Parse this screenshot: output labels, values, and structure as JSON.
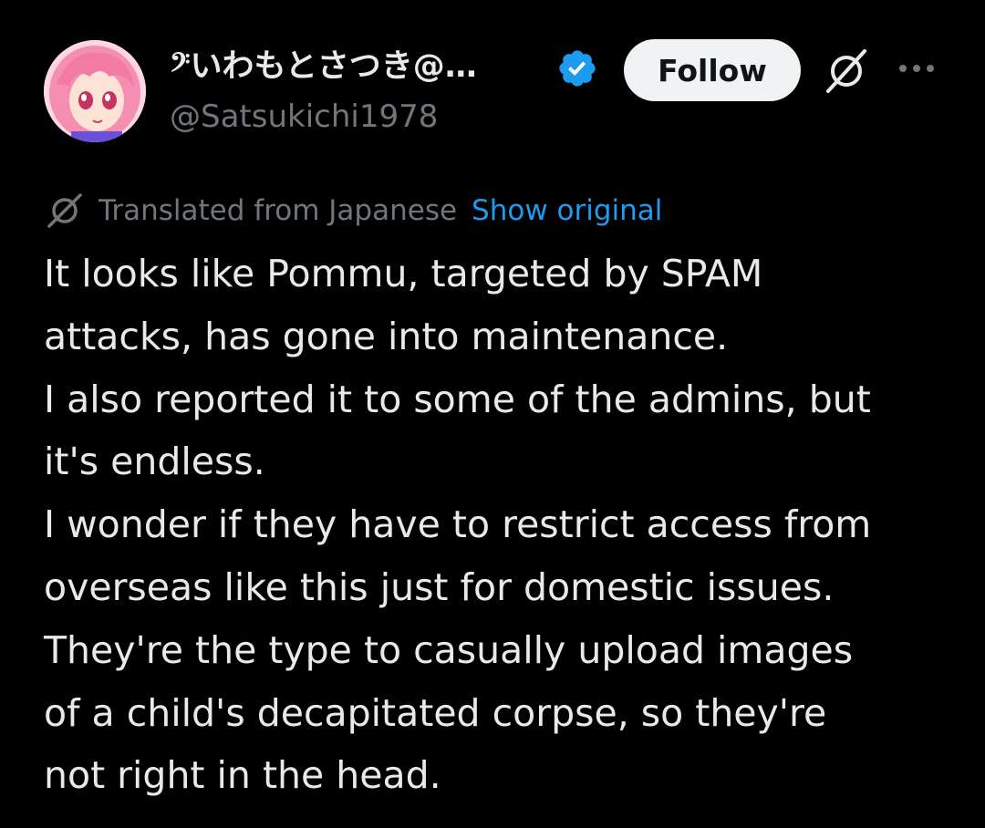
{
  "user": {
    "display_name": "𝄢いわもとさつき@…",
    "handle": "@Satsukichi1978",
    "verified_icon": "verified-badge-icon",
    "verified_color": "#1d9bf0"
  },
  "actions": {
    "follow_label": "Follow",
    "grok_icon": "grok-icon",
    "more_icon": "more-options-icon"
  },
  "translation": {
    "icon": "translate-icon",
    "label": "Translated from Japanese",
    "show_original_label": "Show original"
  },
  "tweet": {
    "lines": [
      "It looks like Pommu, targeted by SPAM",
      "attacks, has gone into maintenance.",
      "I also reported it to some of the admins, but",
      "it's endless.",
      "I wonder if they have to restrict access from",
      "overseas like this just for domestic issues.",
      "They're the type to casually upload images",
      "of a child's decapitated corpse, so they're",
      "not right in the head."
    ]
  },
  "colors": {
    "background": "#000000",
    "text_primary": "#e7e9ea",
    "text_secondary": "#71767b",
    "link": "#1d9bf0",
    "follow_button_bg": "#eff3f4"
  }
}
